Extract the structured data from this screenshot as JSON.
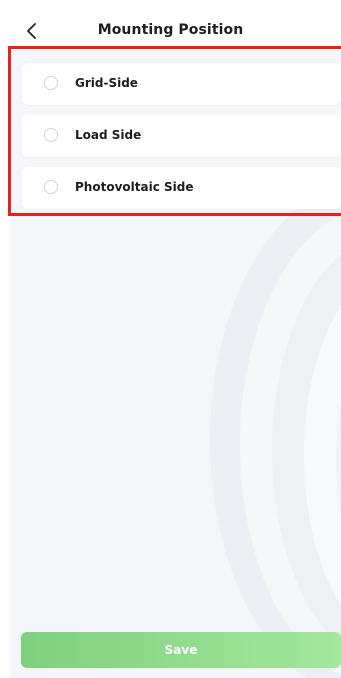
{
  "header": {
    "title": "Mounting Position",
    "back_icon": "chevron-left-icon"
  },
  "options": [
    {
      "label": "Grid-Side",
      "selected": false
    },
    {
      "label": "Load Side",
      "selected": false
    },
    {
      "label": "Photovoltaic Side",
      "selected": false
    }
  ],
  "footer": {
    "save_label": "Save"
  },
  "colors": {
    "accent_green_start": "#7fd07e",
    "accent_green_end": "#a4e89d",
    "highlight_red": "#ec1f1f",
    "background": "#f4f6f9"
  }
}
